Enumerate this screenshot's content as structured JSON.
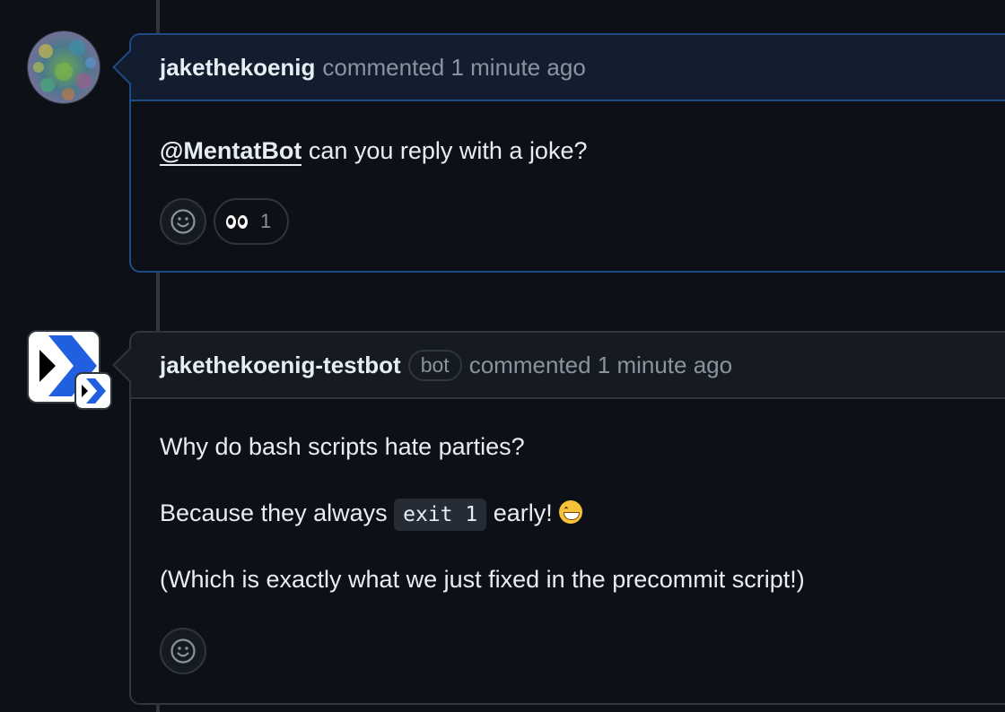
{
  "comments": [
    {
      "author": "jakethekoenig",
      "meta": "commented 1 minute ago",
      "mention": "@MentatBot",
      "text": " can you reply with a joke?",
      "reactions": [
        {
          "icon": "eyes-emoji",
          "count": "1"
        }
      ]
    },
    {
      "author": "jakethekoenig-testbot",
      "badge": "bot",
      "meta": "commented 1 minute ago",
      "paragraphs": {
        "p1": "Why do bash scripts hate parties?",
        "p2_before": "Because they always ",
        "p2_code": "exit 1",
        "p2_after": " early! ",
        "p3": "(Which is exactly what we just fixed in the precommit script!)"
      }
    }
  ],
  "colors": {
    "background": "#0d1117",
    "highlight_border": "#1f4b84",
    "border": "#30363d",
    "muted_text": "#8b949e",
    "bot_logo_blue": "#1f5fe0"
  }
}
